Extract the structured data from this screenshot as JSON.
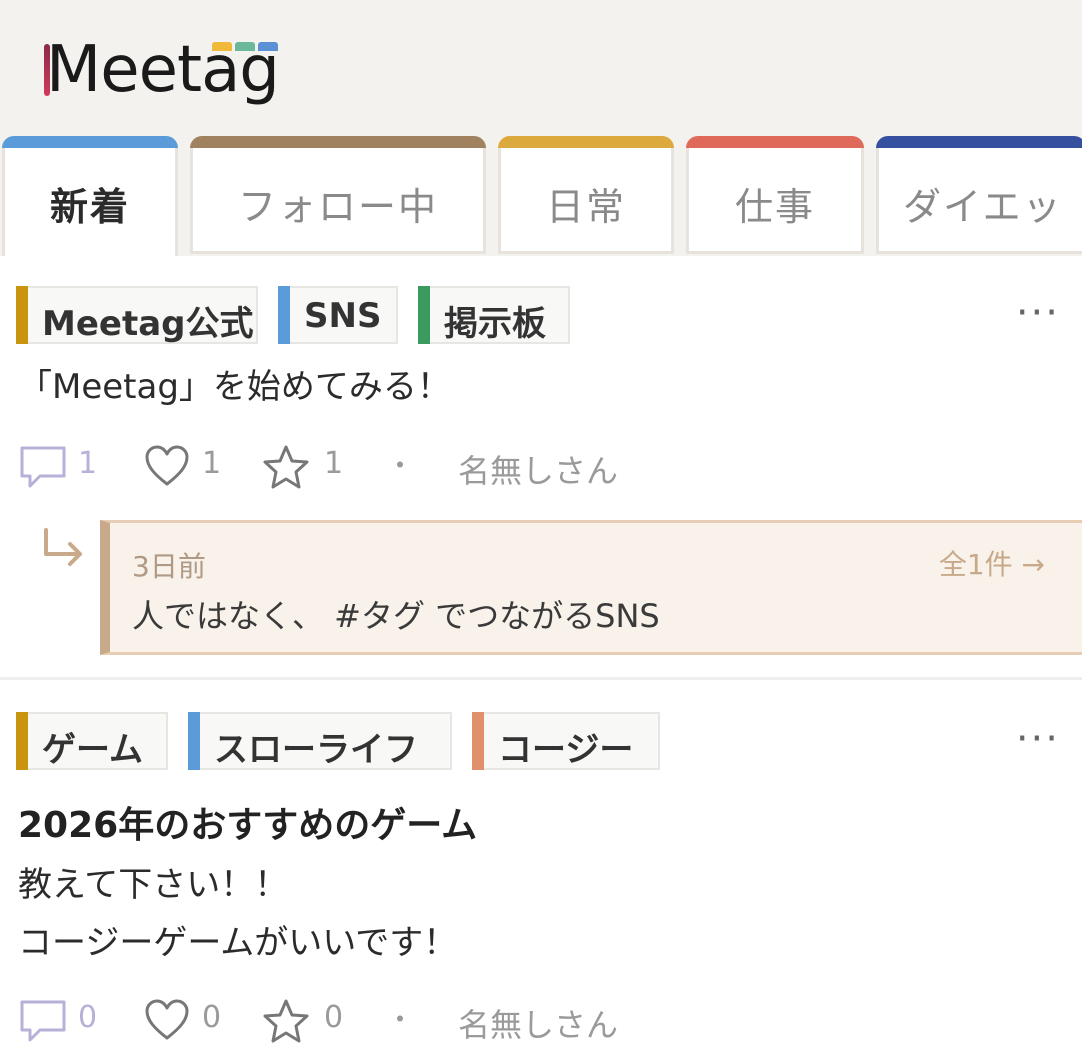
{
  "logo": {
    "text": "Meetag",
    "tab_colors": [
      "#f1b93a",
      "#6cb89a",
      "#5b8fd6"
    ]
  },
  "tabs": [
    {
      "label": "新着",
      "color": "#5b9bd9",
      "active": true
    },
    {
      "label": "フォロー中",
      "color": "#a0825f",
      "active": false
    },
    {
      "label": "日常",
      "color": "#dcaa3c",
      "active": false
    },
    {
      "label": "仕事",
      "color": "#e06a5a",
      "active": false
    },
    {
      "label": "ダイエッ",
      "color": "#3650a0",
      "active": false
    }
  ],
  "posts": [
    {
      "tags": [
        {
          "label": "Meetag公式",
          "color": "#c9950f"
        },
        {
          "label": "SNS",
          "color": "#5b9bd9"
        },
        {
          "label": "掲示板",
          "color": "#3a9a60"
        }
      ],
      "more": "···",
      "title": "",
      "body": [
        "「Meetag」を始めてみる！"
      ],
      "comments": "1",
      "likes": "1",
      "stars": "1",
      "separator": "・",
      "author": "名無しさん",
      "reply": {
        "date": "3日前",
        "all_link": "全1件 →",
        "text": "人ではなく、 #タグ でつながるSNS"
      }
    },
    {
      "tags": [
        {
          "label": "ゲーム",
          "color": "#c9950f"
        },
        {
          "label": "スローライフ",
          "color": "#5b9bd9"
        },
        {
          "label": "コージー",
          "color": "#e0906a"
        }
      ],
      "more": "···",
      "title": "2026年のおすすめのゲーム",
      "body": [
        "教えて下さい！！",
        "コージーゲームがいいです！"
      ],
      "comments": "0",
      "likes": "0",
      "stars": "0",
      "separator": "・",
      "author": "名無しさん"
    }
  ]
}
